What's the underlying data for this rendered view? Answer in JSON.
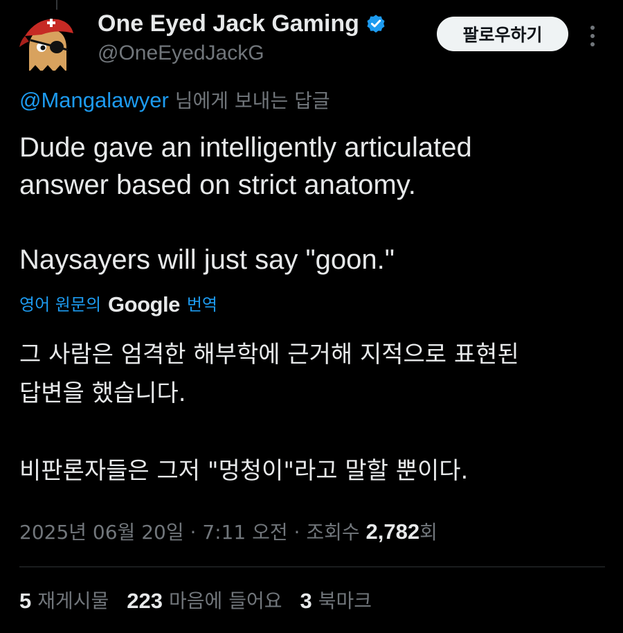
{
  "author": {
    "display_name": "One Eyed Jack Gaming",
    "handle": "@OneEyedJackG",
    "verified": true,
    "avatar_icon": "pirate-ghost-avatar-icon"
  },
  "actions": {
    "follow_label": "팔로우하기",
    "more_icon": "more-vertical-icon"
  },
  "reply_context": {
    "mention": "@Mangalawyer",
    "suffix": " 님에게 보내는 답글"
  },
  "tweet": {
    "paragraph_1_line_1": "Dude gave an intelligently articulated",
    "paragraph_1_line_2": "answer based on strict anatomy.",
    "paragraph_2": "Naysayers will just say \"goon.\""
  },
  "translation": {
    "prefix": "영어 원문의",
    "provider": "Google",
    "suffix": "번역",
    "paragraph_1_line_1": "그 사람은 엄격한 해부학에 근거해 지적으로 표현된",
    "paragraph_1_line_2": "답변을 했습니다.",
    "paragraph_2": "비판론자들은 그저 \"멍청이\"라고 말할 뿐이다."
  },
  "meta": {
    "date": "2025년 06월 20일",
    "separator": " · ",
    "time": "7:11 오전",
    "views_label": "조회수 ",
    "views_count": "2,782",
    "views_suffix": "회"
  },
  "stats": {
    "reposts_count": "5",
    "reposts_label": "재게시물",
    "likes_count": "223",
    "likes_label": "마음에 들어요",
    "bookmarks_count": "3",
    "bookmarks_label": "북마크"
  },
  "colors": {
    "background": "#000000",
    "text_primary": "#e7e9ea",
    "text_secondary": "#71767b",
    "link_blue": "#1d9bf0",
    "verified_blue": "#1d9bf0",
    "follow_button_bg": "#eff3f4"
  }
}
